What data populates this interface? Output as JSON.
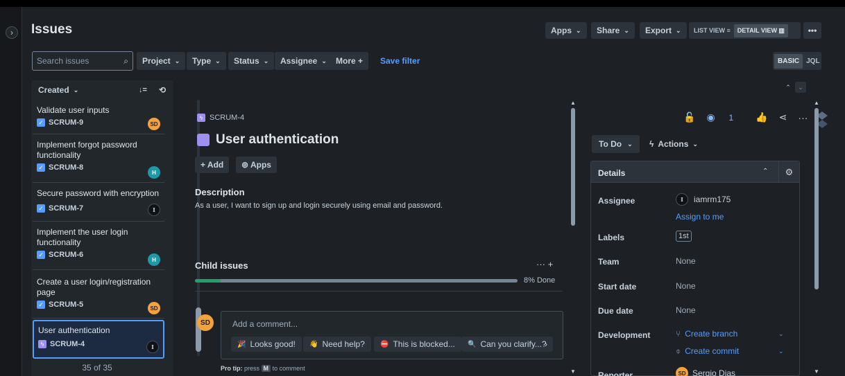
{
  "header": {
    "title": "Issues",
    "apps": "Apps",
    "share": "Share",
    "export": "Export",
    "list_view": "LIST VIEW ≡",
    "detail_view": "DETAIL VIEW ▥",
    "more": "•••"
  },
  "filters": {
    "search_placeholder": "Search issues",
    "project": "Project",
    "type": "Type",
    "status": "Status",
    "assignee": "Assignee",
    "more": "More +",
    "save_filter": "Save filter",
    "basic": "BASIC",
    "jql": "JQL"
  },
  "list": {
    "sort_label": "Created",
    "count": "35 of 35",
    "items": [
      {
        "summary": "Validate user inputs",
        "key": "SCRUM-9",
        "avatar": "SD"
      },
      {
        "summary": "Implement forgot password functionality",
        "key": "SCRUM-8",
        "avatar": "H"
      },
      {
        "summary": "Secure password with encryption",
        "key": "SCRUM-7",
        "avatar": "I"
      },
      {
        "summary": "Implement the user login functionality",
        "key": "SCRUM-6",
        "avatar": "H"
      },
      {
        "summary": "Create a user login/registration page",
        "key": "SCRUM-5",
        "avatar": "SD"
      },
      {
        "summary": "User authentication",
        "key": "SCRUM-4",
        "avatar": "I"
      }
    ]
  },
  "issue": {
    "breadcrumb_key": "SCRUM-4",
    "title": "User authentication",
    "add": "+ Add",
    "apps": "⊚ Apps",
    "description_heading": "Description",
    "description": "As a user, I want to sign up and login securely using email and password.",
    "child_issues_heading": "Child issues",
    "child_tools": "···  +",
    "progress_percent": 8,
    "progress_label": "8% Done",
    "comment_avatar": "SD",
    "comment_placeholder": "Add a comment...",
    "chips": [
      {
        "emoji": "🎉",
        "label": "Looks good!"
      },
      {
        "emoji": "👋",
        "label": "Need help?"
      },
      {
        "emoji": "⛔",
        "label": "This is blocked..."
      },
      {
        "emoji": "🔍",
        "label": "Can you clarify...?"
      }
    ],
    "protip_label": "Pro tip:",
    "protip_pre": "press",
    "protip_key": "M",
    "protip_post": "to comment"
  },
  "side": {
    "watch_count": "1",
    "status": "To Do",
    "actions": "Actions",
    "details_heading": "Details",
    "fields": {
      "assignee_label": "Assignee",
      "assignee_avatar": "I",
      "assignee_value": "iamrm175",
      "assign_to_me": "Assign to me",
      "labels_label": "Labels",
      "labels_value": "1st",
      "team_label": "Team",
      "team_value": "None",
      "start_label": "Start date",
      "start_value": "None",
      "due_label": "Due date",
      "due_value": "None",
      "development_label": "Development",
      "create_branch": "Create branch",
      "create_commit": "Create commit",
      "reporter_label": "Reporter",
      "reporter_avatar": "SD",
      "reporter_value": "Sergio Dias"
    }
  },
  "colors": {
    "background": "#1d2125",
    "accent_blue": "#579dff",
    "epic_purple": "#9f8fef",
    "progress_green": "#22a06b",
    "avatar_orange": "#f5a13c",
    "avatar_teal": "#1d9aaa"
  }
}
